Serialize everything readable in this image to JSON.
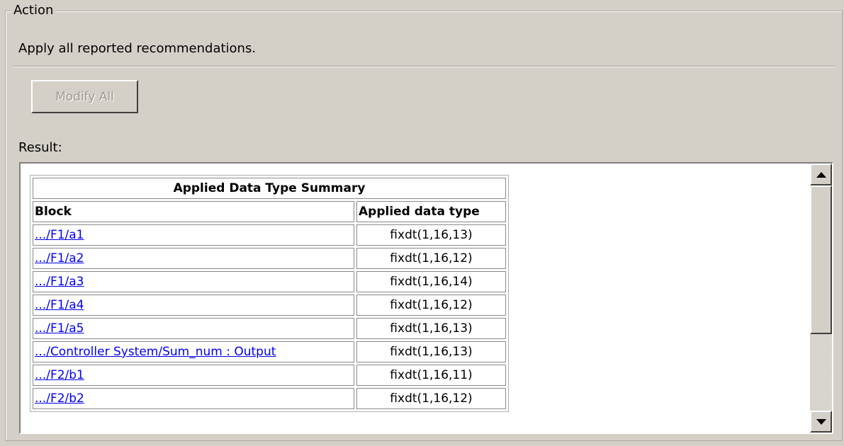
{
  "action": {
    "group_title": "Action",
    "description": "Apply all reported recommendations.",
    "modify_button_label": "Modify All",
    "modify_button_enabled": false
  },
  "result": {
    "label": "Result:",
    "table": {
      "title": "Applied Data Type Summary",
      "columns": [
        "Block",
        "Applied data type"
      ],
      "rows": [
        {
          "block": ".../F1/a1",
          "type": "fixdt(1,16,13)"
        },
        {
          "block": ".../F1/a2",
          "type": "fixdt(1,16,12)"
        },
        {
          "block": ".../F1/a3",
          "type": "fixdt(1,16,14)"
        },
        {
          "block": ".../F1/a4",
          "type": "fixdt(1,16,12)"
        },
        {
          "block": ".../F1/a5",
          "type": "fixdt(1,16,13)"
        },
        {
          "block": ".../Controller System/Sum_num : Output",
          "type": "fixdt(1,16,13)"
        },
        {
          "block": ".../F2/b1",
          "type": "fixdt(1,16,11)"
        },
        {
          "block": ".../F2/b2",
          "type": "fixdt(1,16,12)"
        }
      ]
    }
  },
  "colors": {
    "panel_bg": "#d4d0c8",
    "link": "#0000ee",
    "disabled_text": "#9d9a91"
  },
  "icons": {
    "scroll_up": "scroll-up-arrow-icon",
    "scroll_down": "scroll-down-arrow-icon"
  }
}
